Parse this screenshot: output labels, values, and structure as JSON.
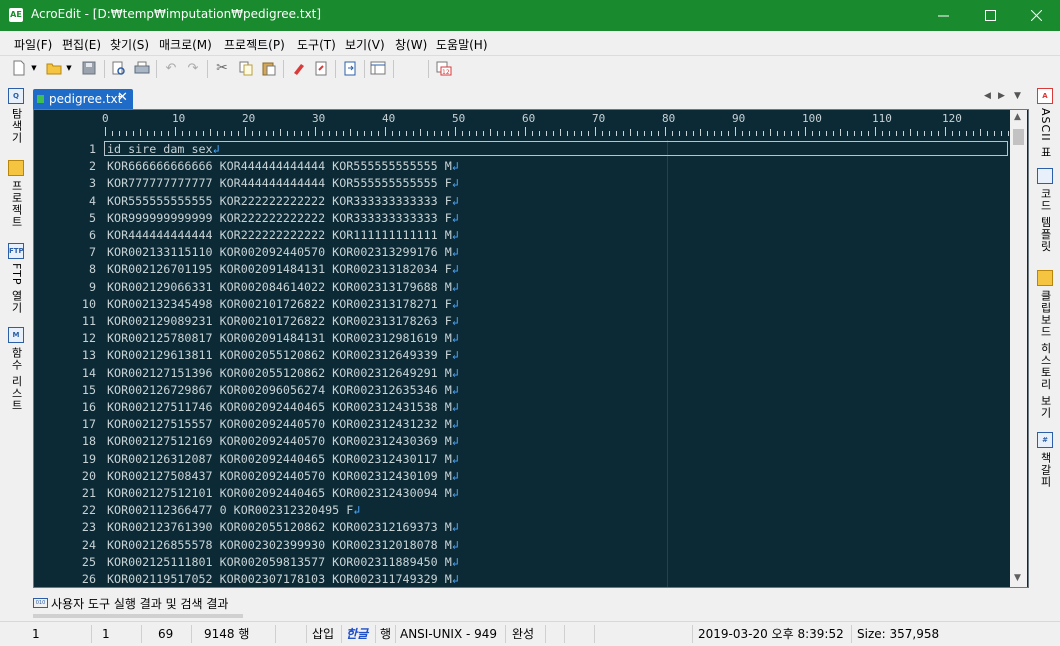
{
  "window": {
    "title": "AcroEdit - [D:₩temp₩imputation₩pedigree.txt]"
  },
  "menu": [
    "파일(F)",
    "편집(E)",
    "찾기(S)",
    "매크로(M)",
    "프로젝트(P)",
    "도구(T)",
    "보기(V)",
    "창(W)",
    "도움말(H)"
  ],
  "left_panel": [
    {
      "label": "탐색기",
      "icon": "explorer-icon"
    },
    {
      "label": "프로젝트",
      "icon": "project-icon"
    },
    {
      "label": "FTP 열기",
      "icon": "ftp-icon"
    },
    {
      "label": "함수 리스트",
      "icon": "function-list-icon"
    }
  ],
  "right_panel": [
    {
      "label": "ASCII 표",
      "icon": "ascii-table-icon"
    },
    {
      "label": "코드 템플릿",
      "icon": "code-template-icon"
    },
    {
      "label": "클립보드 히스토리 보기",
      "icon": "clipboard-icon"
    },
    {
      "label": "책갈피",
      "icon": "bookmark-icon"
    }
  ],
  "tab": {
    "label": "pedigree.txt",
    "close": "✕"
  },
  "ruler": [
    "0",
    "10",
    "20",
    "30",
    "40",
    "50",
    "60",
    "70",
    "80",
    "90",
    "100",
    "110",
    "120"
  ],
  "lines": [
    {
      "num": "1",
      "text": "id sire dam sex"
    },
    {
      "num": "2",
      "text": "KOR666666666666 KOR444444444444 KOR555555555555 M"
    },
    {
      "num": "3",
      "text": "KOR777777777777 KOR444444444444 KOR555555555555 F"
    },
    {
      "num": "4",
      "text": "KOR555555555555 KOR222222222222 KOR333333333333 F"
    },
    {
      "num": "5",
      "text": "KOR999999999999 KOR222222222222 KOR333333333333 F"
    },
    {
      "num": "6",
      "text": "KOR444444444444 KOR222222222222 KOR111111111111 M"
    },
    {
      "num": "7",
      "text": "KOR002133115110 KOR002092440570 KOR002313299176 M"
    },
    {
      "num": "8",
      "text": "KOR002126701195 KOR002091484131 KOR002313182034 F"
    },
    {
      "num": "9",
      "text": "KOR002129066331 KOR002084614022 KOR002313179688 M"
    },
    {
      "num": "10",
      "text": "KOR002132345498 KOR002101726822 KOR002313178271 F"
    },
    {
      "num": "11",
      "text": "KOR002129089231 KOR002101726822 KOR002313178263 F"
    },
    {
      "num": "12",
      "text": "KOR002125780817 KOR002091484131 KOR002312981619 M"
    },
    {
      "num": "13",
      "text": "KOR002129613811 KOR002055120862 KOR002312649339 F"
    },
    {
      "num": "14",
      "text": "KOR002127151396 KOR002055120862 KOR002312649291 M"
    },
    {
      "num": "15",
      "text": "KOR002126729867 KOR002096056274 KOR002312635346 M"
    },
    {
      "num": "16",
      "text": "KOR002127511746 KOR002092440465 KOR002312431538 M"
    },
    {
      "num": "17",
      "text": "KOR002127515557 KOR002092440570 KOR002312431232 M"
    },
    {
      "num": "18",
      "text": "KOR002127512169 KOR002092440570 KOR002312430369 M"
    },
    {
      "num": "19",
      "text": "KOR002126312087 KOR002092440465 KOR002312430117 M"
    },
    {
      "num": "20",
      "text": "KOR002127508437 KOR002092440570 KOR002312430109 M"
    },
    {
      "num": "21",
      "text": "KOR002127512101 KOR002092440465 KOR002312430094 M"
    },
    {
      "num": "22",
      "text": "KOR002112366477 0 KOR002312320495 F"
    },
    {
      "num": "23",
      "text": "KOR002123761390 KOR002055120862 KOR002312169373 M"
    },
    {
      "num": "24",
      "text": "KOR002126855578 KOR002302399930 KOR002312018078 M"
    },
    {
      "num": "25",
      "text": "KOR002125111801 KOR002059813577 KOR002311889450 M"
    },
    {
      "num": "26",
      "text": "KOR002119517052 KOR002307178103 KOR002311749329 M"
    }
  ],
  "eol_symbol": "↲",
  "output_panel": {
    "label": "사용자 도구 실행 결과 및 검색 결과"
  },
  "status": {
    "line": "1",
    "col": "1",
    "chars": "69",
    "total_lines": "9148 행",
    "insert": "삽입",
    "ime": "한글",
    "row": "행",
    "encoding": "ANSI-UNIX - 949",
    "complete": "완성",
    "datetime": "2019-03-20 오후 8:39:52",
    "size": "Size: 357,958"
  },
  "colors": {
    "titlebar": "#1a8a2e",
    "editor_bg": "#0c2a35",
    "editor_text": "#c8d3d6",
    "eol": "#4aa8ff",
    "tab_active": "#1e6cc8"
  }
}
